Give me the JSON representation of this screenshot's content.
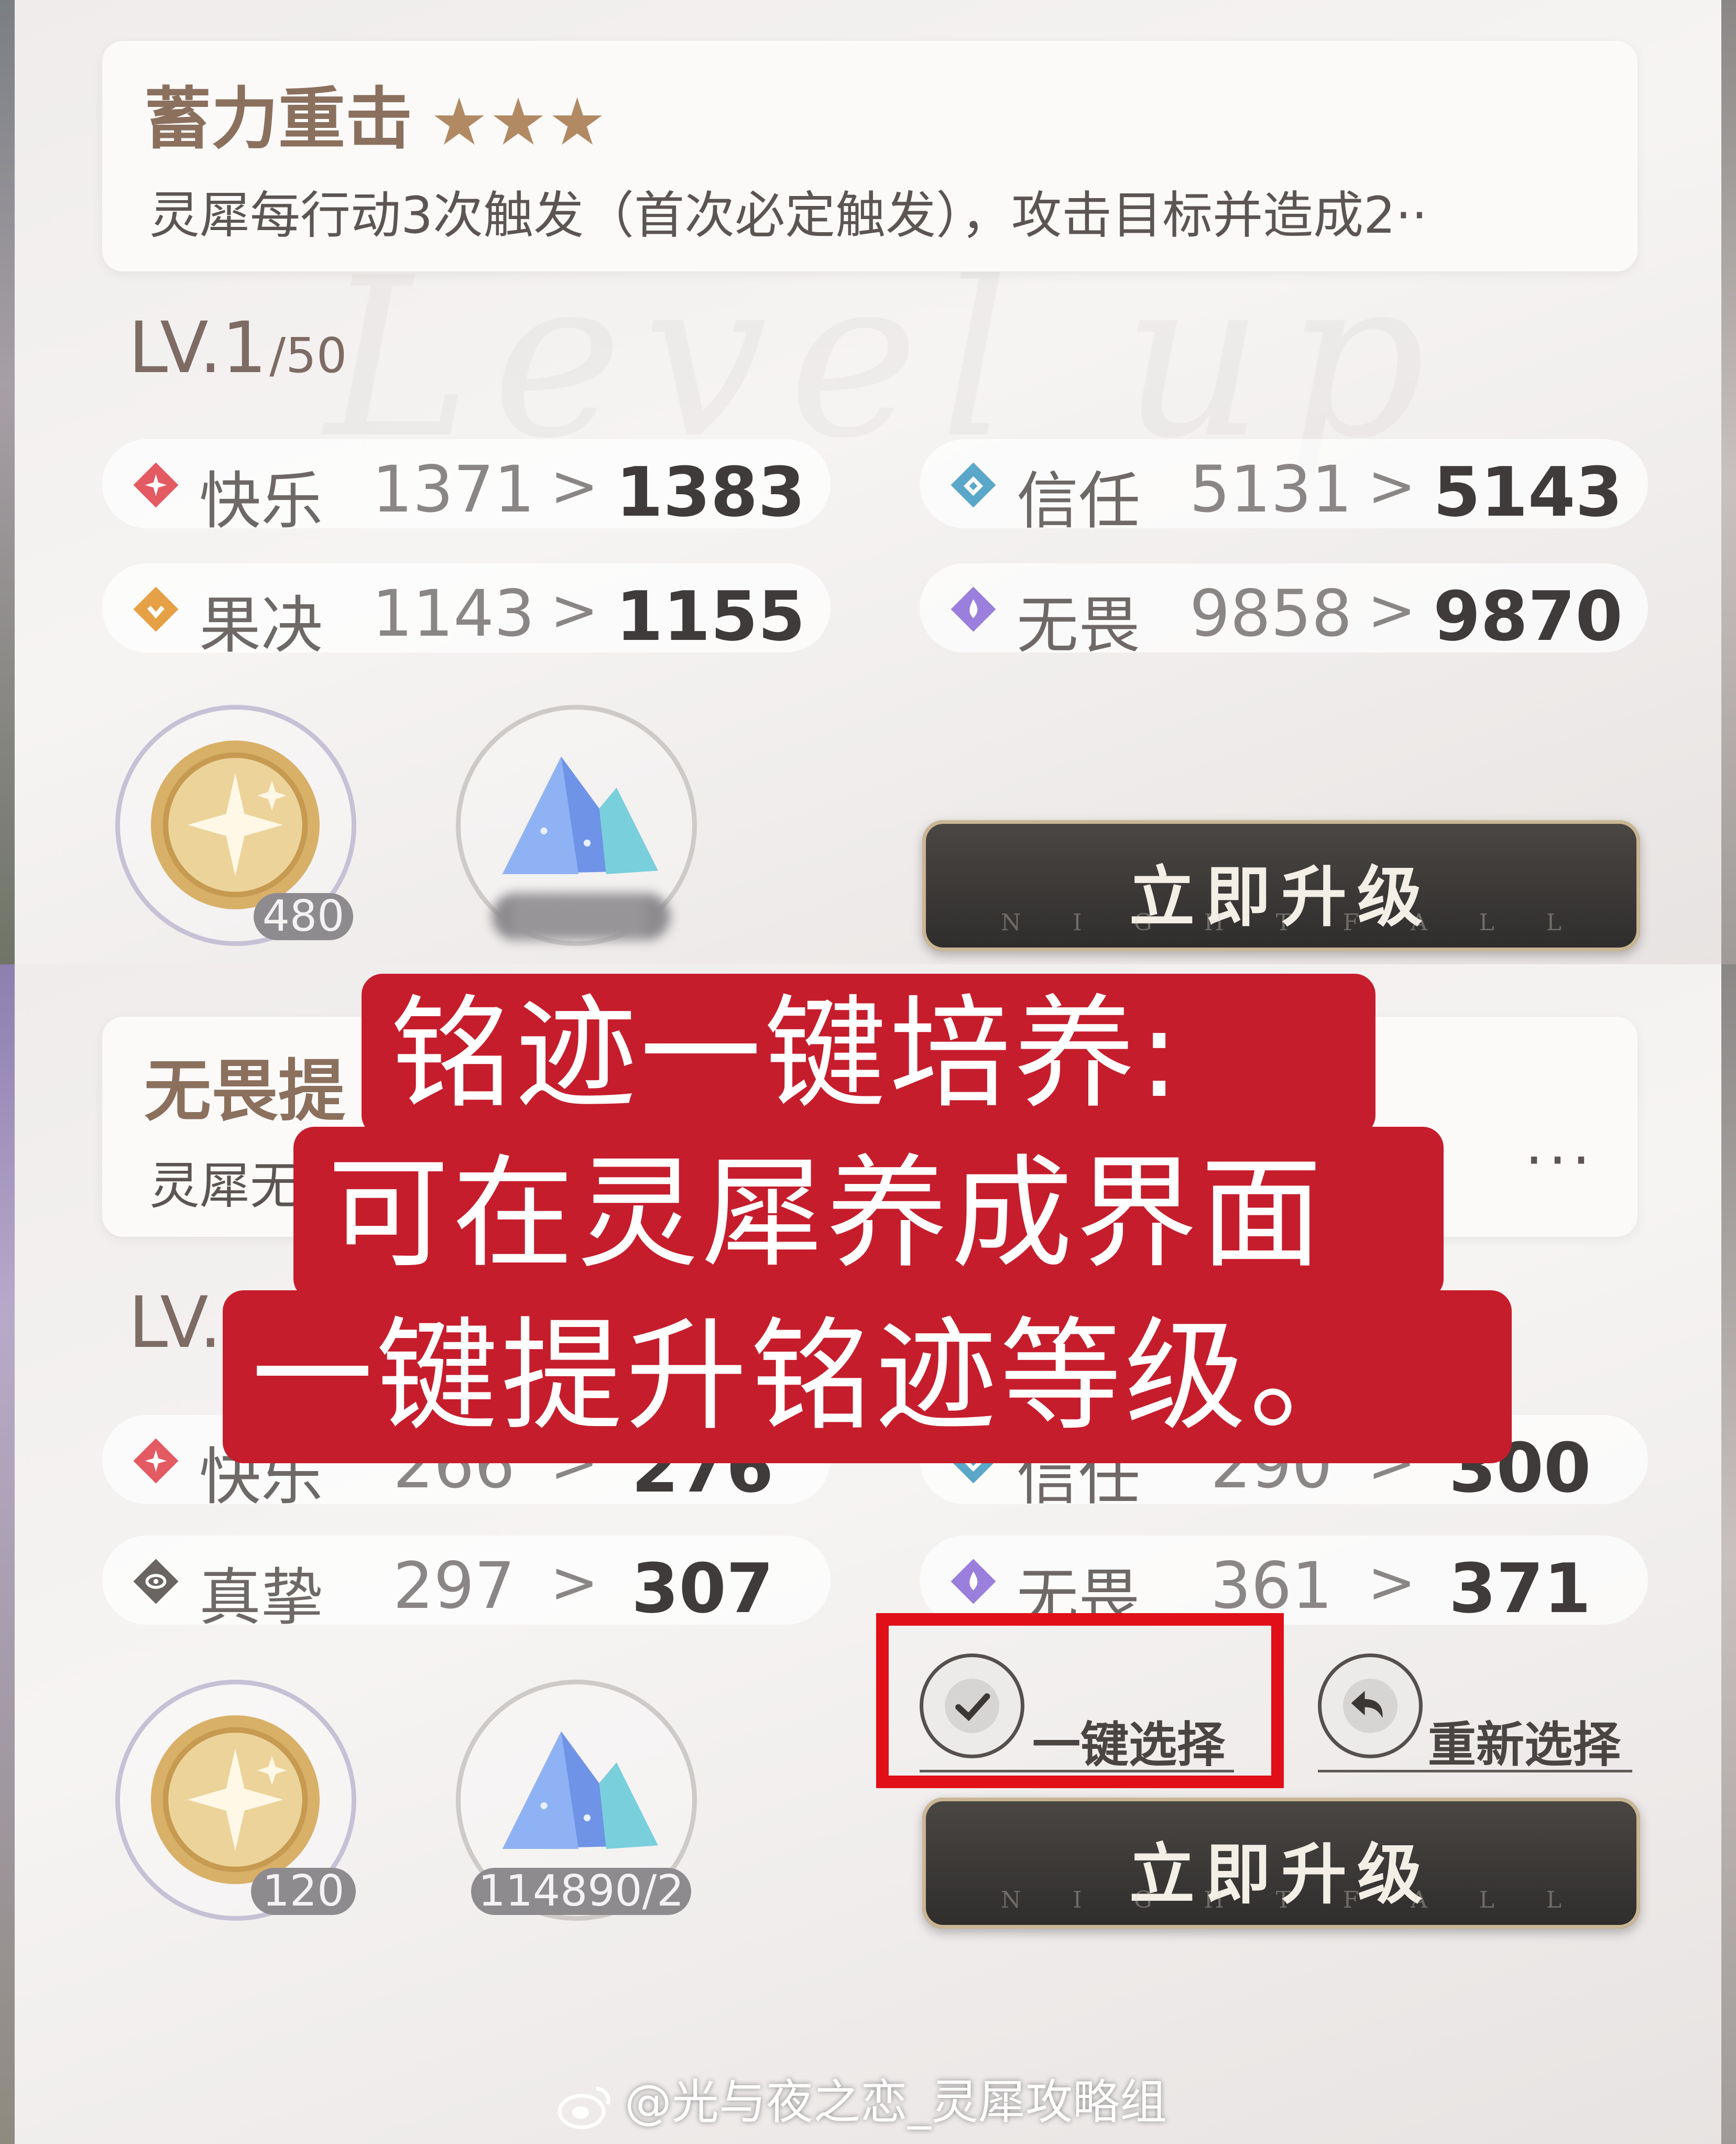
{
  "top": {
    "skill": {
      "name": "蓄力重击",
      "stars": "★★★",
      "description": "灵犀每行动3次触发（首次必定触发），攻击目标并造成2··"
    },
    "level": {
      "current": "LV.1",
      "max": "/50"
    },
    "stats": [
      {
        "name": "快乐",
        "old": "1371",
        "arrow": ">",
        "new": "1383",
        "icon": "happiness-icon",
        "color": "#e35a63"
      },
      {
        "name": "信任",
        "old": "5131",
        "arrow": ">",
        "new": "5143",
        "icon": "trust-icon",
        "color": "#5aa7c9"
      },
      {
        "name": "果决",
        "old": "1143",
        "arrow": ">",
        "new": "1155",
        "icon": "decisiveness-icon",
        "color": "#e6a045"
      },
      {
        "name": "无畏",
        "old": "9858",
        "arrow": ">",
        "new": "9870",
        "icon": "fearless-icon",
        "color": "#9a7fdc"
      }
    ],
    "resources": [
      {
        "icon": "gold-coin-icon",
        "count": "480"
      },
      {
        "icon": "blue-crystal-icon",
        "count": ""
      }
    ],
    "upgrade_button": {
      "label": "立即升级",
      "sub": [
        "N",
        "I",
        "G",
        "H",
        "T",
        "F",
        "A",
        "L",
        "L"
      ]
    }
  },
  "bottom": {
    "skill": {
      "name": "无畏提",
      "description": "灵犀无",
      "more": "···"
    },
    "level": {
      "current": "LV."
    },
    "stats": [
      {
        "name": "快乐",
        "old": "266",
        "arrow": ">",
        "new": "276",
        "icon": "happiness-icon",
        "color": "#e35a63"
      },
      {
        "name": "信任",
        "old": "290",
        "arrow": ">",
        "new": "300",
        "icon": "trust-icon",
        "color": "#5aa7c9"
      },
      {
        "name": "真挚",
        "old": "297",
        "arrow": ">",
        "new": "307",
        "icon": "sincerity-icon",
        "color": "#6a6463"
      },
      {
        "name": "无畏",
        "old": "361",
        "arrow": ">",
        "new": "371",
        "icon": "fearless-icon",
        "color": "#9a7fdc"
      }
    ],
    "resources": [
      {
        "icon": "gold-coin-icon",
        "count": "120"
      },
      {
        "icon": "blue-crystal-icon",
        "count": "114890/2"
      }
    ],
    "one_click_select": "一键选择",
    "reselect": "重新选择",
    "upgrade_button": {
      "label": "立即升级",
      "sub": [
        "N",
        "I",
        "G",
        "H",
        "T",
        "F",
        "A",
        "L",
        "L"
      ]
    }
  },
  "banner": {
    "line1": "铭迹一键培养:",
    "line2": "可在灵犀养成界面",
    "line3": "一键提升铭迹等级。"
  },
  "watermark": "@光与夜之恋_灵犀攻略组",
  "colors": {
    "highlight": "#e10f17",
    "banner": "#c61d2c",
    "button": "#353231"
  }
}
